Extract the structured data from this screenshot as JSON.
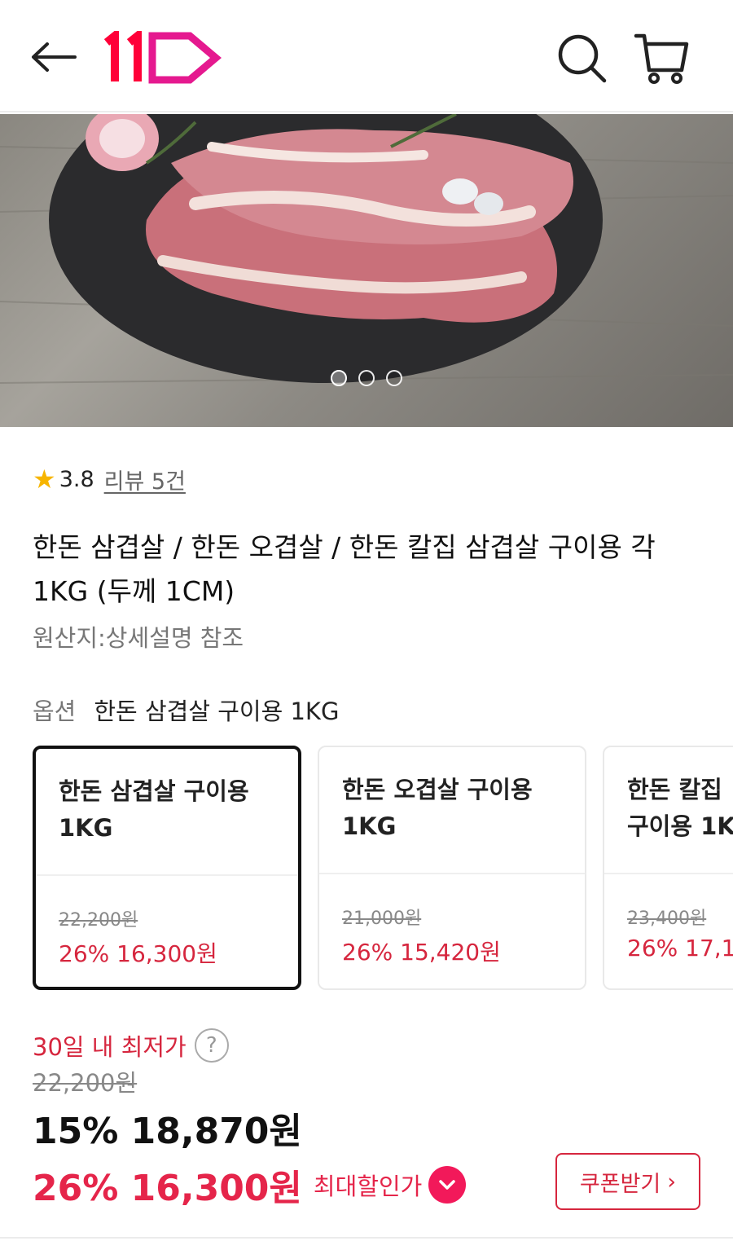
{
  "header": {
    "logo_alt": "11",
    "icons": [
      "back-arrow-icon",
      "11st-logo",
      "search-icon",
      "cart-icon"
    ],
    "colors": {
      "logo_red": "#ff0038",
      "logo_magenta": "#e5198f"
    }
  },
  "gallery": {
    "image": "pork-belly-on-slate-board",
    "dot_count": 3,
    "active_dot": 1
  },
  "rating": {
    "score": "3.8",
    "review_link": "리뷰 5건"
  },
  "product": {
    "title": "한돈 삼겹살 / 한돈 오겹살 / 한돈 칼집 삼겹살  구이용 각 1KG (두께 1CM)",
    "origin": "원산지:상세설명 참조"
  },
  "option": {
    "label": "옵션",
    "selected": "한돈 삼겹살 구이용 1KG",
    "cards": [
      {
        "name_line1": "한돈 삼겹살 구이용",
        "name_line2": "1KG",
        "original": "22,200원",
        "sale": "26% 16,300원"
      },
      {
        "name_line1": "한돈 오겹살 구이용",
        "name_line2": "1KG",
        "original": "21,000원",
        "sale": "26% 15,420원"
      },
      {
        "name_line1": "한돈 칼집",
        "name_line2": "구이용 1K",
        "original": "23,400원",
        "sale": "26% 17,1"
      }
    ]
  },
  "price": {
    "lowest_label": "30일 내 최저가",
    "help": "?",
    "original": "22,200원",
    "discounted": "15% 18,870원",
    "max_discount_value": "26% 16,300원",
    "max_discount_label": "최대할인가",
    "coupon_button": "쿠폰받기",
    "coupon_arrow": "›"
  },
  "colors": {
    "accent_red": "#d6263e",
    "max_price_red": "#e5254a",
    "badge_pink": "#f2195a",
    "star": "#f7b500"
  }
}
